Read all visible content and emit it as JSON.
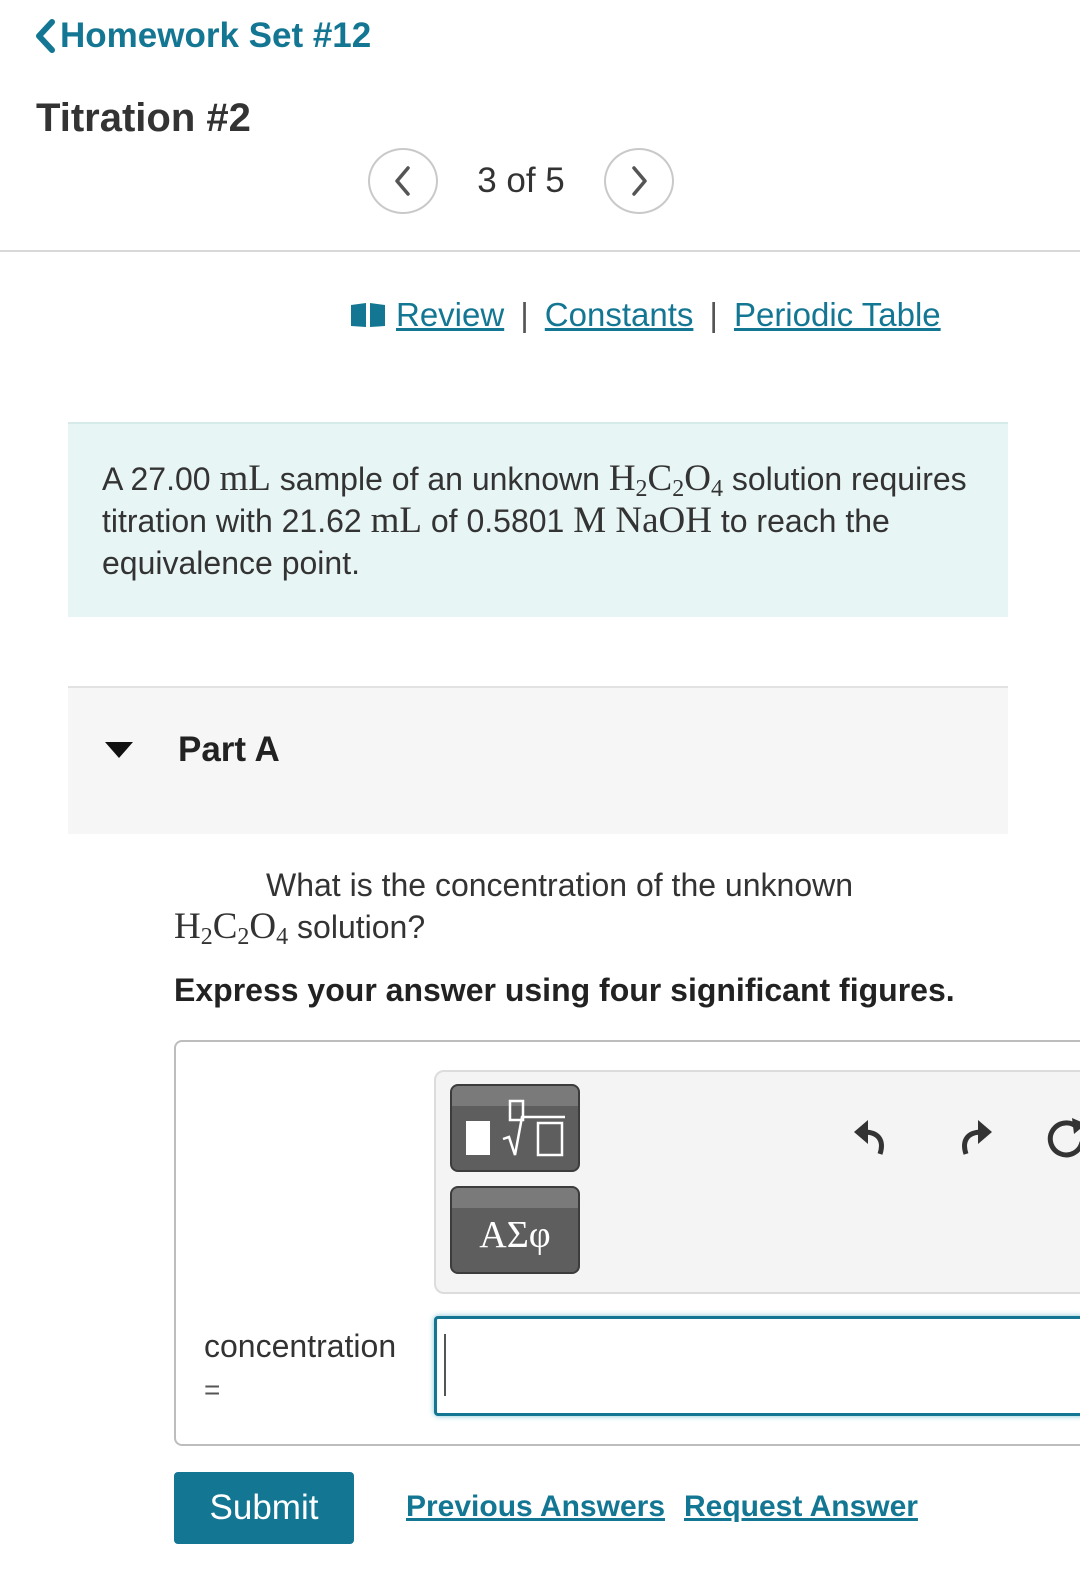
{
  "header": {
    "back_label": "Homework Set #12",
    "title": "Titration #2"
  },
  "pager": {
    "text": "3 of 5"
  },
  "resources": {
    "review": "Review",
    "constants": "Constants",
    "periodic_table": "Periodic Table",
    "separator": "|"
  },
  "problem": {
    "text_1": "A 27.00 ",
    "unit_ml_1": "mL",
    "text_2": " sample of an unknown ",
    "text_3": " solution requires titration with 21.62 ",
    "unit_ml_2": "mL",
    "text_4": " of 0.5801 ",
    "molarity": "M NaOH",
    "text_5": " to reach the equivalence point."
  },
  "part": {
    "title": "Part A",
    "question_1": "What is the concentration of the unknown",
    "question_2": " solution?",
    "instruction": "Express your answer using four significant figures."
  },
  "formula": {
    "H": "H",
    "H_sub": "2",
    "C": "C",
    "C_sub": "2",
    "O": "O",
    "O_sub": "4"
  },
  "answer": {
    "label": "concentration",
    "equals": "=",
    "value": "",
    "greek_button": "ΑΣφ"
  },
  "actions": {
    "submit": "Submit",
    "previous_answers": "Previous Answers",
    "request_answer": "Request Answer"
  },
  "colors": {
    "accent": "#137693",
    "problem_bg": "#e8f5f5",
    "part_bg": "#f6f6f6",
    "toolbar_button": "#5e5e5e"
  }
}
